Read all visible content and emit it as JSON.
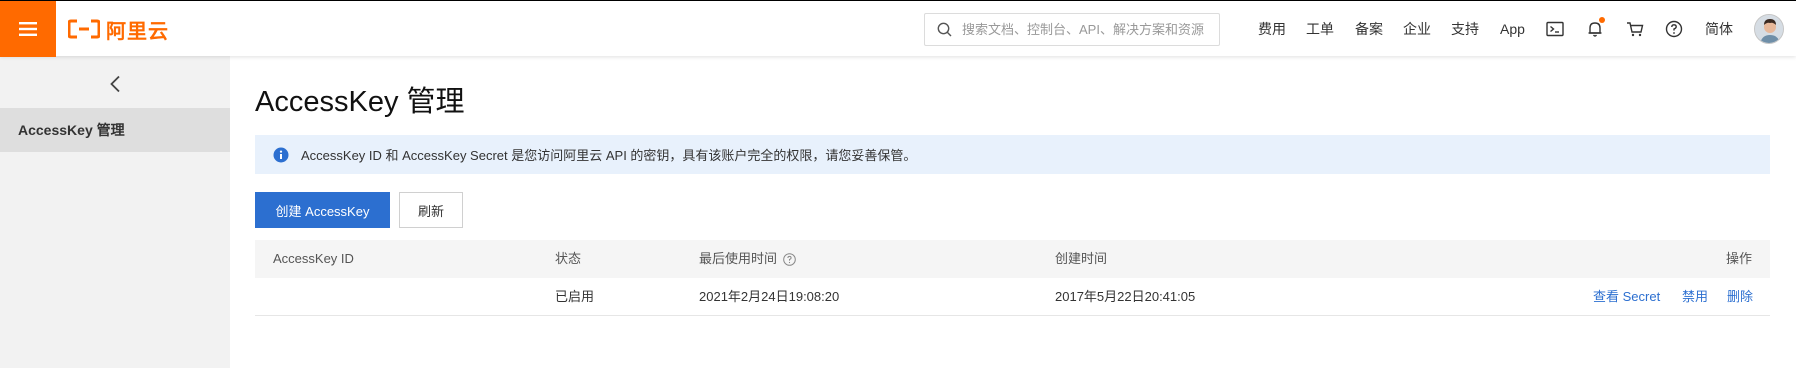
{
  "header": {
    "logo_text": "阿里云",
    "search_placeholder": "搜索文档、控制台、API、解决方案和资源",
    "nav": [
      "费用",
      "工单",
      "备案",
      "企业",
      "支持",
      "App"
    ],
    "language": "简体",
    "brand_color": "#ff6a00"
  },
  "sidebar": {
    "items": [
      {
        "label": "AccessKey 管理",
        "active": true
      }
    ]
  },
  "main": {
    "title": "AccessKey 管理",
    "notice": "AccessKey ID 和 AccessKey Secret 是您访问阿里云 API 的密钥，具有该账户完全的权限，请您妥善保管。",
    "create_button": "创建 AccessKey",
    "refresh_button": "刷新",
    "accent_color": "#2c6fd0",
    "table": {
      "columns": [
        "AccessKey ID",
        "状态",
        "最后使用时间",
        "创建时间",
        "操作"
      ],
      "rows": [
        {
          "id": "",
          "status": "已启用",
          "last_used": "2021年2月24日19:08:20",
          "created": "2017年5月22日20:41:05",
          "actions": [
            "查看 Secret",
            "禁用",
            "删除"
          ]
        }
      ]
    }
  }
}
